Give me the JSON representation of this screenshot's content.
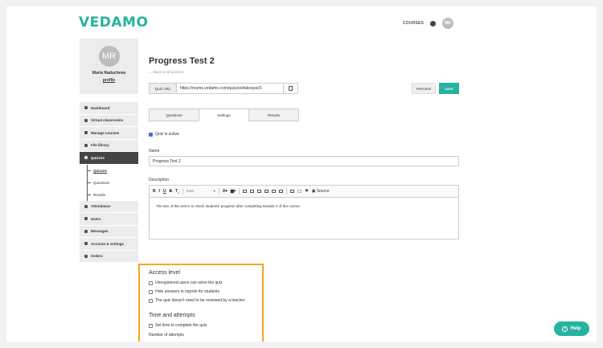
{
  "brand": {
    "logo": "VEDAMO",
    "accent": "#26b3a0"
  },
  "topnav": {
    "courses": "COURSES",
    "avatar": "MR"
  },
  "profile": {
    "initials": "MR",
    "name": "Maria Raducheva",
    "link": "profile"
  },
  "menu": {
    "dashboard": "Dashboard",
    "virtual_classrooms": "Virtual classrooms",
    "manage_courses": "Manage courses",
    "file_library": "File library",
    "quizzes": "Quizzes",
    "sub_quizzes": "Quizzes",
    "sub_questions": "Questions",
    "sub_results": "Results",
    "attendance": "Attendance",
    "users": "Users",
    "messages": "Messages",
    "account_settings": "Account & settings",
    "orders": "Orders"
  },
  "quiz": {
    "title": "Progress Test 2",
    "back": "← Back to all quizzes",
    "url_label": "Quiz URL",
    "url": "https://rooms.vedamo.com/quizzes/takequiz/3",
    "preview": "PREVIEW",
    "save": "SAVE"
  },
  "tabs": {
    "questions": "Questions",
    "settings": "Settings",
    "results": "Results"
  },
  "settings": {
    "active": "Quiz is active",
    "name_label": "Name",
    "name_value": "Progress Test 2",
    "desc_label": "Description",
    "font": "Font",
    "source": "Source",
    "desc_text": "The aim of this test is to check students' progress after completing Module 2 of the course."
  },
  "access": {
    "heading": "Access level",
    "opt1": "Unregistered users can solve the quiz",
    "opt2": "Hide answers in reports for students",
    "opt3": "The quiz doesn't need to be reviewed by a teacher"
  },
  "time": {
    "heading": "Time and attempts",
    "opt1": "Set time to complete the quiz",
    "attempts_label": "Number of attempts"
  },
  "help": {
    "label": "Help"
  }
}
